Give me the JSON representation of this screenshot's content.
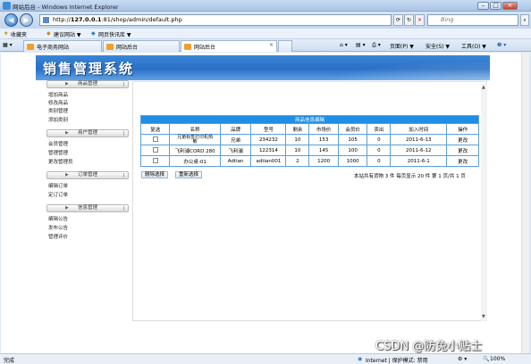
{
  "window": {
    "title": "网站后台 - Windows Internet Explorer"
  },
  "address": {
    "url_prefix": "http://",
    "url_host": "127.0.0.1",
    "url_rest": ":81/shop/admin/default.php",
    "search_placeholder": "Bing"
  },
  "favorites": {
    "label": "收藏夹",
    "item1": "建议网站 ▼",
    "item2": "网页快讯库 ▼"
  },
  "tabs": [
    {
      "label": "电子商务网站"
    },
    {
      "label": "网站后台"
    },
    {
      "label": "网站后台"
    }
  ],
  "commands": {
    "page": "页面(P) ▼",
    "safety": "安全(S) ▼",
    "tools": "工具(O) ▼",
    "help": "❷ ▼"
  },
  "app": {
    "title": "销售管理系统"
  },
  "menu": [
    {
      "header": "商品管理",
      "items": [
        "增加商品",
        "修改商品",
        "类别管理",
        "添加类别"
      ]
    },
    {
      "header": "用户管理",
      "items": [
        "会员管理",
        "管理管理",
        "更改管理员"
      ]
    },
    {
      "header": "订单管理",
      "items": [
        "编辑订单",
        "定订订单"
      ]
    },
    {
      "header": "信息管理",
      "items": [
        "编辑公告",
        "发布公告",
        "管理评价"
      ]
    }
  ],
  "table": {
    "caption": "商品信息编辑",
    "headers": [
      "复选",
      "名称",
      "品牌",
      "型号",
      "剩余",
      "市场价",
      "会员价",
      "卖出",
      "加入时间",
      "操作"
    ],
    "rows": [
      [
        "",
        "兄弟标签打印机热\n敏",
        "兄弟",
        "234232",
        "10",
        "153",
        "105",
        "0",
        "2011-6-13",
        "更改"
      ],
      [
        "",
        "飞利浦CORD 280",
        "飞利浦",
        "122314",
        "10",
        "145",
        "100",
        "0",
        "2011-6-12",
        "更改"
      ],
      [
        "",
        "办公桌-01",
        "Adtian",
        "adtian001",
        "2",
        "1200",
        "1000",
        "0",
        "2011-6-1",
        "更改"
      ]
    ]
  },
  "actions": {
    "delete": "删除选择",
    "reset": "重新选择"
  },
  "pager": {
    "text": "本站共有货物 3 件  每页显示 20 件  第 1 页/共 1 页"
  },
  "status": {
    "left": "完成",
    "zone": "Internet | 保护模式: 禁用",
    "zoom": "100%"
  },
  "watermark": "CSDN @防兔小贴士"
}
